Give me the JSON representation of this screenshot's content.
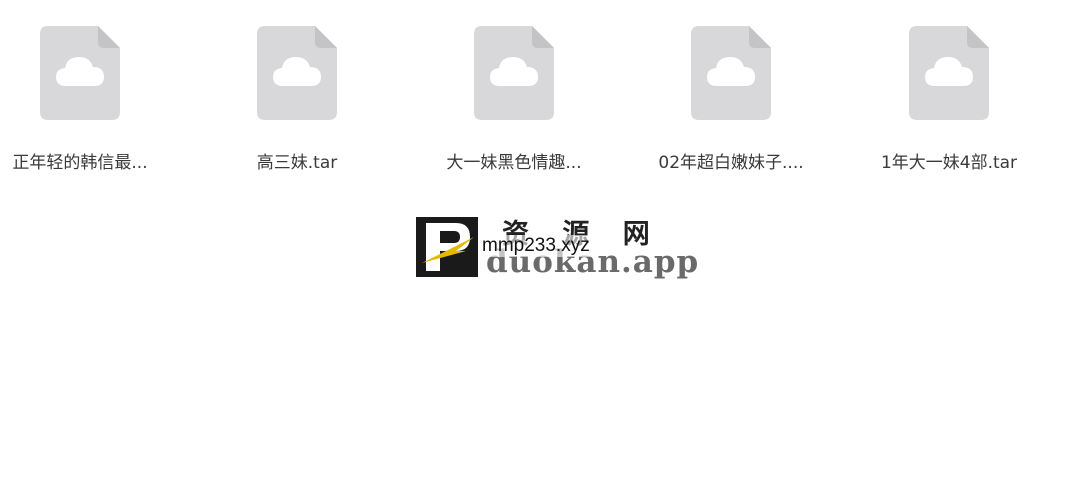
{
  "files": [
    {
      "name": "正年轻的韩信最...",
      "icon": "cloud-file-icon"
    },
    {
      "name": "高三妹.tar",
      "icon": "cloud-file-icon"
    },
    {
      "name": "大一妹黑色情趣...",
      "icon": "cloud-file-icon"
    },
    {
      "name": "02年超白嫩妹子....",
      "icon": "cloud-file-icon"
    },
    {
      "name": "1年大一妹4部.tar",
      "icon": "cloud-file-icon"
    }
  ],
  "watermark": {
    "brand_cn": "资 源 网",
    "brand_domain": "duokan.app",
    "overlay_text": "mmp233.xyz",
    "logo_letter": "P"
  },
  "colors": {
    "icon_fill": "#d8d8da",
    "icon_fold": "#c4c4c7",
    "cloud": "#ffffff",
    "logo_bg": "#1a1a1a",
    "logo_accent": "#e6b800"
  }
}
